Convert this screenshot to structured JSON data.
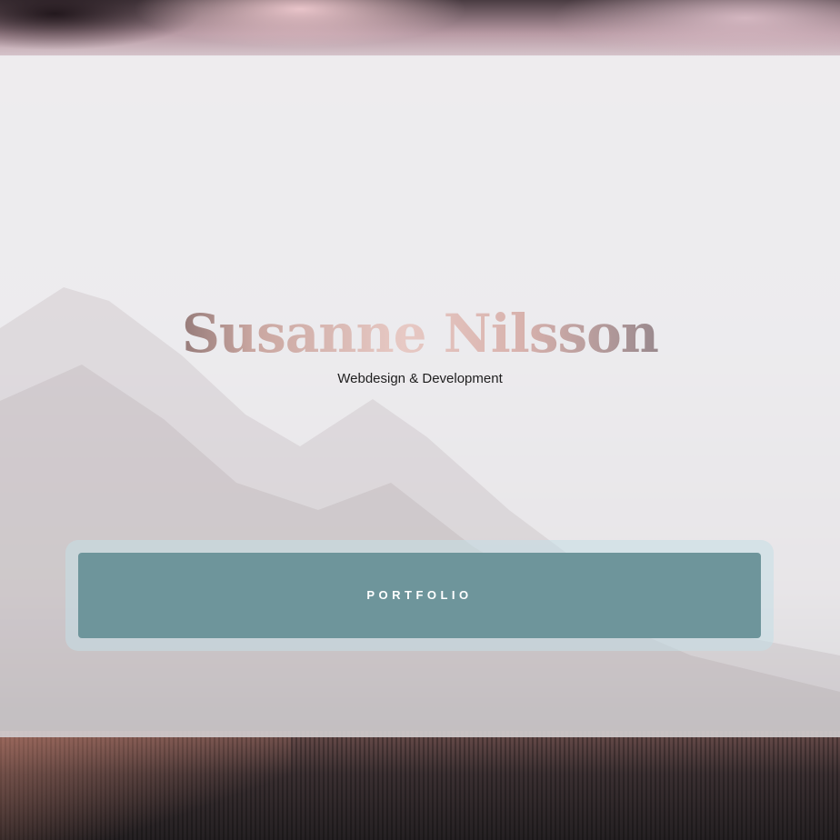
{
  "hero": {
    "title": "Susanne Nilsson",
    "subtitle": "Webdesign & Development",
    "cta_label": "PORTFOLIO"
  },
  "colors": {
    "button": "#6e959b",
    "button_ring": "#c4dee6",
    "panel": "#f0f0f2",
    "title_gradient": [
      "#2c2426",
      "#e7c9c4",
      "#5a5357"
    ]
  }
}
